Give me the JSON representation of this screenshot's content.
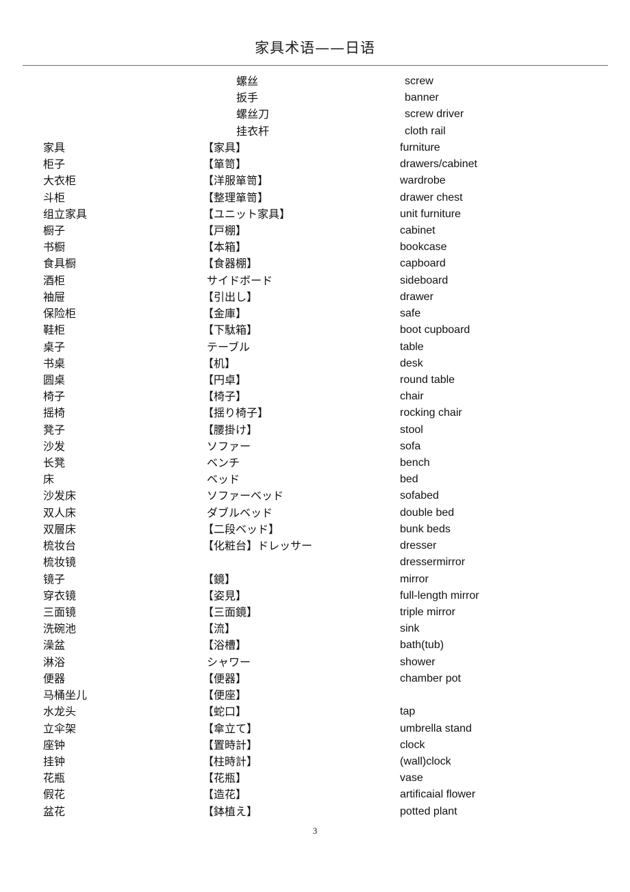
{
  "document": {
    "title": "家具术语——日语",
    "page_number": "3"
  },
  "columns": {
    "chinese_header": "",
    "japanese_header": "",
    "english_header": ""
  },
  "entries": [
    {
      "cn": "",
      "jp": "螺丝",
      "en": "screw",
      "style": "head"
    },
    {
      "cn": "",
      "jp": "扳手",
      "en": "banner",
      "style": "head"
    },
    {
      "cn": "",
      "jp": "螺丝刀",
      "en": "screw driver",
      "style": "head"
    },
    {
      "cn": "",
      "jp": "挂衣杆",
      "en": "cloth rail",
      "style": "head"
    },
    {
      "cn": "家具",
      "jp": "【家具】",
      "en": "furniture",
      "style": "normal"
    },
    {
      "cn": "柜子",
      "jp": "【箪笥】",
      "en": "drawers/cabinet",
      "style": "normal"
    },
    {
      "cn": "大衣柜",
      "jp": "【洋服箪笥】",
      "en": "wardrobe",
      "style": "normal"
    },
    {
      "cn": "斗柜",
      "jp": "【整理箪笥】",
      "en": "drawer chest",
      "style": "normal"
    },
    {
      "cn": "组立家具",
      "jp": "【ユニット家具】",
      "en": "unit furniture",
      "style": "normal"
    },
    {
      "cn": "橱子",
      "jp": "【戸棚】",
      "en": "cabinet",
      "style": "normal"
    },
    {
      "cn": "书橱",
      "jp": "【本箱】",
      "en": "bookcase",
      "style": "normal"
    },
    {
      "cn": "食具橱",
      "jp": "【食器棚】",
      "en": "capboard",
      "style": "normal"
    },
    {
      "cn": "酒柜",
      "jp": "サイドボード",
      "en": "sideboard",
      "style": "kana"
    },
    {
      "cn": "袖屉",
      "jp": "【引出し】",
      "en": "drawer",
      "style": "normal"
    },
    {
      "cn": "保险柜",
      "jp": "【金庫】",
      "en": "safe",
      "style": "normal"
    },
    {
      "cn": "鞋柜",
      "jp": "【下駄箱】",
      "en": "boot cupboard",
      "style": "normal"
    },
    {
      "cn": "桌子",
      "jp": "テーブル",
      "en": "table",
      "style": "kana"
    },
    {
      "cn": "书桌",
      "jp": "【机】",
      "en": "desk",
      "style": "normal"
    },
    {
      "cn": "圆桌",
      "jp": "【円卓】",
      "en": "round table",
      "style": "normal"
    },
    {
      "cn": "椅子",
      "jp": "【椅子】",
      "en": "chair",
      "style": "normal"
    },
    {
      "cn": "摇椅",
      "jp": "【揺り椅子】",
      "en": "rocking chair",
      "style": "normal"
    },
    {
      "cn": "凳子",
      "jp": "【腰掛け】",
      "en": "stool",
      "style": "normal"
    },
    {
      "cn": "沙发",
      "jp": "ソファー",
      "en": "sofa",
      "style": "kana"
    },
    {
      "cn": "长凳",
      "jp": "ベンチ",
      "en": "bench",
      "style": "kana"
    },
    {
      "cn": "床",
      "jp": "ベッド",
      "en": "bed",
      "style": "kana"
    },
    {
      "cn": "沙发床",
      "jp": "ソファーベッド",
      "en": "sofabed",
      "style": "kana"
    },
    {
      "cn": "双人床",
      "jp": "ダブルベッド",
      "en": "double bed",
      "style": "kana"
    },
    {
      "cn": "双層床",
      "jp": "【二段ベッド】",
      "en": "bunk beds",
      "style": "normal"
    },
    {
      "cn": "梳妆台",
      "jp": "【化粧台】ドレッサー",
      "en": "dresser",
      "style": "normal"
    },
    {
      "cn": "梳妆镜",
      "jp": "",
      "en": "dressermirror",
      "style": "normal"
    },
    {
      "cn": "镜子",
      "jp": "【鏡】",
      "en": "mirror",
      "style": "normal"
    },
    {
      "cn": "穿衣镜",
      "jp": "【姿見】",
      "en": "full-length mirror",
      "style": "normal"
    },
    {
      "cn": "三面镜",
      "jp": "【三面鏡】",
      "en": "triple mirror",
      "style": "normal"
    },
    {
      "cn": "洗碗池",
      "jp": "【流】",
      "en": "sink",
      "style": "normal"
    },
    {
      "cn": "澡盆",
      "jp": "【浴槽】",
      "en": "bath(tub)",
      "style": "normal"
    },
    {
      "cn": "淋浴",
      "jp": "シャワー",
      "en": "shower",
      "style": "kana"
    },
    {
      "cn": "便器",
      "jp": "【便器】",
      "en": "chamber pot",
      "style": "normal"
    },
    {
      "cn": "马桶坐儿",
      "jp": "【便座】",
      "en": "",
      "style": "normal"
    },
    {
      "cn": "水龙头",
      "jp": "【蛇口】",
      "en": "tap",
      "style": "normal"
    },
    {
      "cn": "立伞架",
      "jp": "【傘立て】",
      "en": "umbrella stand",
      "style": "normal"
    },
    {
      "cn": "座钟",
      "jp": "【置時計】",
      "en": "clock",
      "style": "normal"
    },
    {
      "cn": "挂钟",
      "jp": "【柱時計】",
      "en": "(wall)clock",
      "style": "normal"
    },
    {
      "cn": "花瓶",
      "jp": "【花瓶】",
      "en": "vase",
      "style": "normal"
    },
    {
      "cn": "假花",
      "jp": "【造花】",
      "en": "artificaial flower",
      "style": "normal"
    },
    {
      "cn": "盆花",
      "jp": "【鉢植え】",
      "en": "potted plant",
      "style": "normal"
    }
  ]
}
